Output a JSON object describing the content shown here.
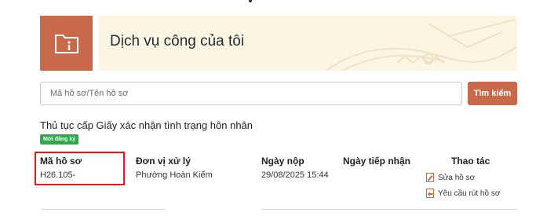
{
  "banner": {
    "title": "Dịch vụ công của tôi",
    "icon": "folder-info-icon",
    "accent": "#c8694a",
    "background": "#fbf5e1"
  },
  "search": {
    "placeholder": "Mã hồ sơ/Tên hồ sơ",
    "value": "",
    "button_label": "Tìm kiếm"
  },
  "record": {
    "title": "Thủ tục cấp Giấy xác nhận tình trạng hôn nhân",
    "badge": "Mới đăng ký",
    "badge_color": "#2eaa4a",
    "columns": {
      "code": "Mã hồ sơ",
      "unit": "Đơn vị xử lý",
      "submit_date": "Ngày nộp",
      "receive_date": "Ngày tiếp nhận",
      "actions": "Thao tác"
    },
    "values": {
      "code": "H26.105-",
      "unit": "Phường Hoàn Kiếm",
      "submit_date": "29/08/2025 15:44",
      "receive_date": ""
    },
    "actions": [
      {
        "label": "Sửa hồ sơ",
        "icon": "edit-document-icon"
      },
      {
        "label": "Yêu cầu rút hồ sơ",
        "icon": "withdraw-document-icon"
      }
    ]
  },
  "highlight_color": "#e21a1a"
}
